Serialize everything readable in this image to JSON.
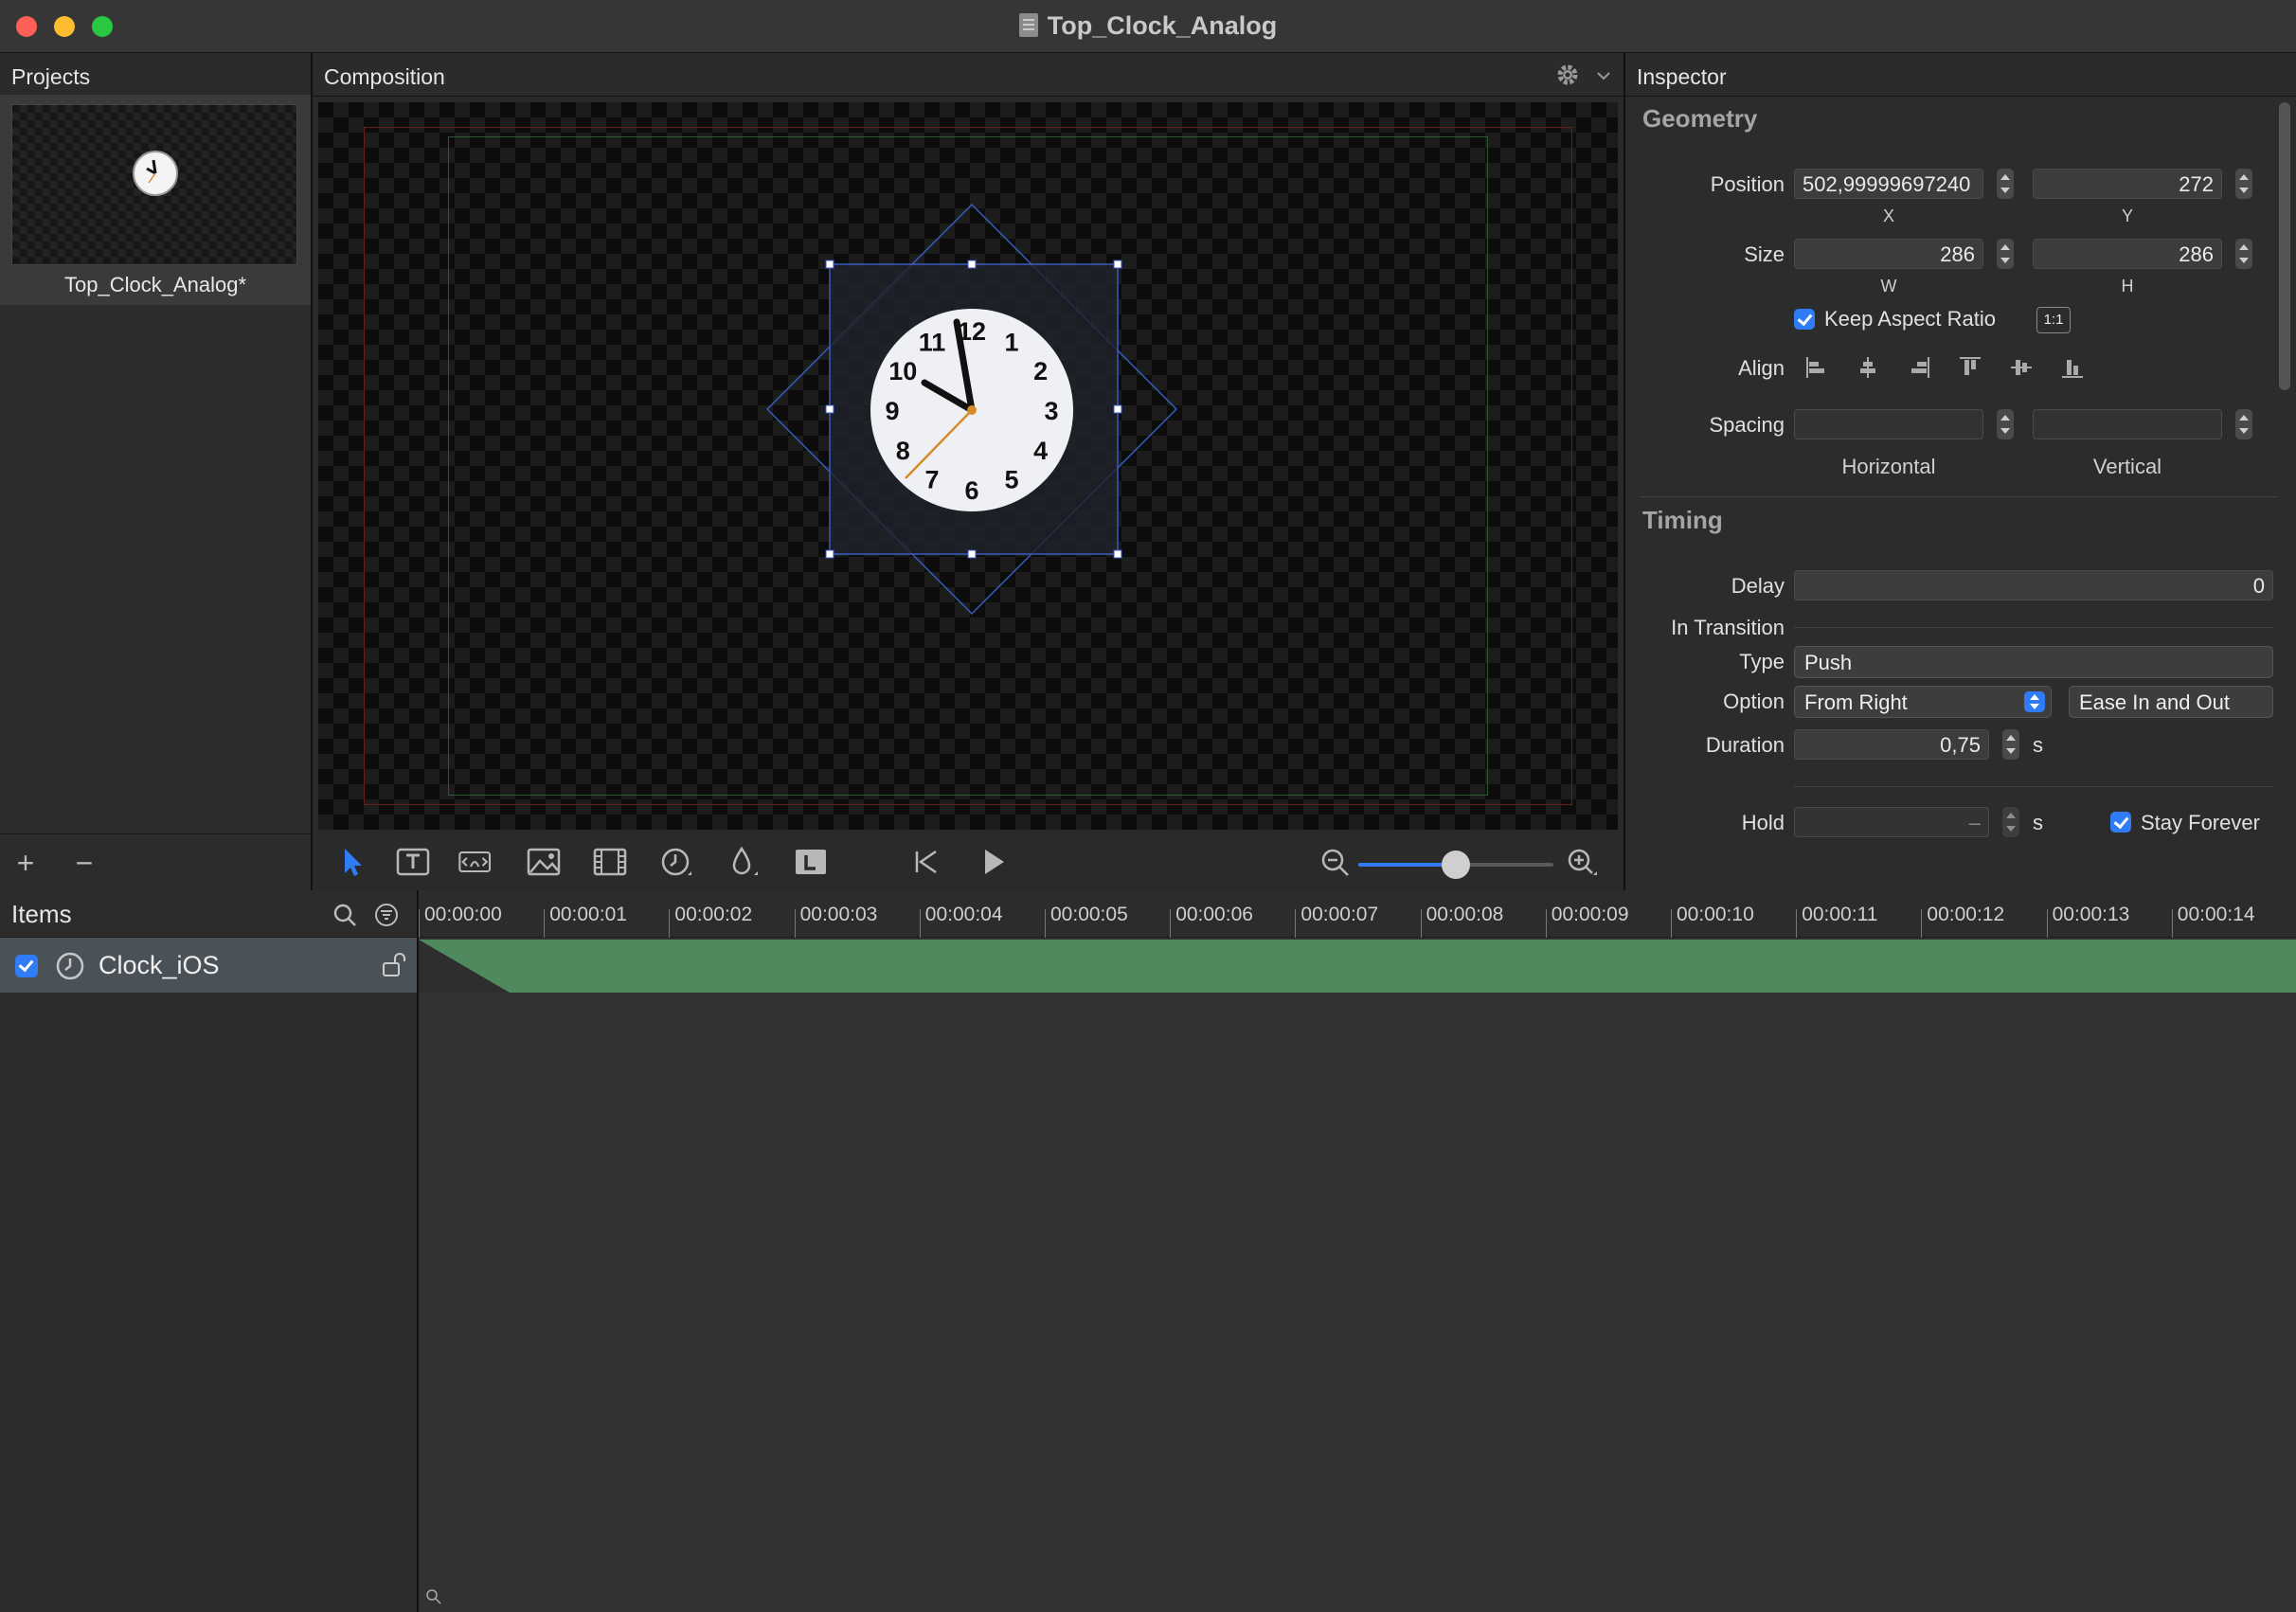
{
  "window": {
    "title": "Top_Clock_Analog"
  },
  "projects": {
    "header": "Projects",
    "items": [
      {
        "name": "Top_Clock_Analog*"
      }
    ],
    "add_label": "+",
    "remove_label": "−"
  },
  "composition": {
    "header": "Composition",
    "clock_numbers": [
      "12",
      "1",
      "2",
      "3",
      "4",
      "5",
      "6",
      "7",
      "8",
      "9",
      "10",
      "11"
    ],
    "zoom_level": 0.5
  },
  "inspector": {
    "header": "Inspector",
    "geometry": {
      "title": "Geometry",
      "position_label": "Position",
      "position_x": "502,99999697240",
      "position_y": "272",
      "x_label": "X",
      "y_label": "Y",
      "size_label": "Size",
      "size_w": "286",
      "size_h": "286",
      "w_label": "W",
      "h_label": "H",
      "keep_aspect_label": "Keep Aspect Ratio",
      "keep_aspect_checked": true,
      "ratio_button": "1:1",
      "align_label": "Align",
      "spacing_label": "Spacing",
      "horizontal_label": "Horizontal",
      "vertical_label": "Vertical"
    },
    "timing": {
      "title": "Timing",
      "delay_label": "Delay",
      "delay_value": "0",
      "in_transition_label": "In Transition",
      "type_label": "Type",
      "type_value": "Push",
      "option_label": "Option",
      "option_value": "From Right",
      "easing_value": "Ease In and Out",
      "duration_label": "Duration",
      "duration_value": "0,75",
      "duration_unit": "s",
      "hold_label": "Hold",
      "hold_value": "–",
      "hold_unit": "s",
      "stay_forever_label": "Stay Forever",
      "stay_forever_checked": true
    }
  },
  "items": {
    "header": "Items",
    "rows": [
      {
        "name": "Clock_iOS",
        "enabled": true
      }
    ]
  },
  "timeline": {
    "ticks": [
      "00:00:00",
      "00:00:01",
      "00:00:02",
      "00:00:03",
      "00:00:04",
      "00:00:05",
      "00:00:06",
      "00:00:07",
      "00:00:08",
      "00:00:09",
      "00:00:10",
      "00:00:11",
      "00:00:12",
      "00:00:13",
      "00:00:14"
    ]
  },
  "colors": {
    "accent": "#2f7cf6",
    "track": "#4f8a5f",
    "close": "#ff5f57",
    "minimize": "#febc2e",
    "zoom": "#28c840"
  }
}
